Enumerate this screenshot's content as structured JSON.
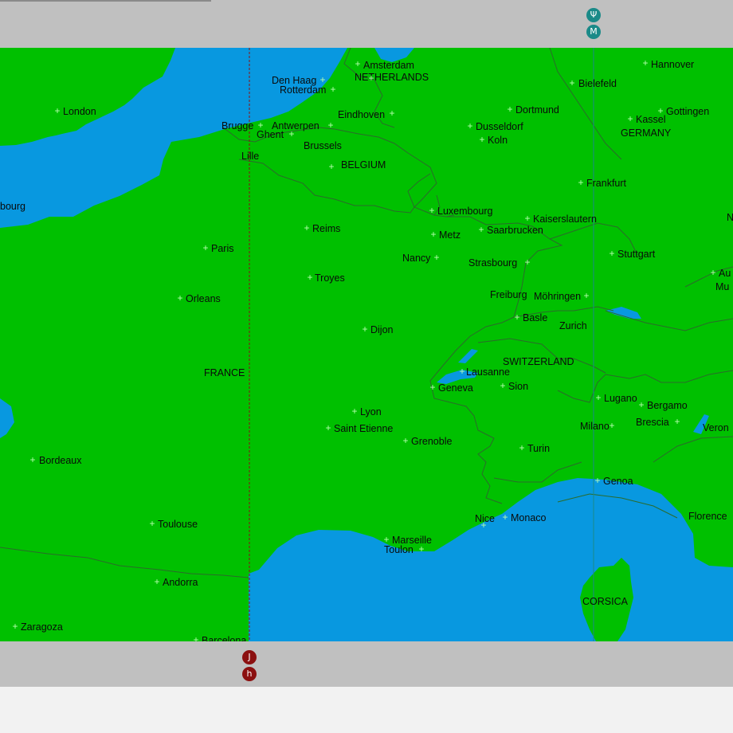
{
  "colors": {
    "land": "#00c000",
    "water": "#0898e0",
    "toolbar": "#c0c0c0",
    "cursor_a": "#1a8a88",
    "cursor_b": "#8b1010"
  },
  "countries": {
    "netherlands": "NETHERLANDS",
    "belgium": "BELGIUM",
    "germany": "GERMANY",
    "france": "FRANCE",
    "switzerland": "SWITZERLAND",
    "corsica": "CORSICA"
  },
  "cities": [
    {
      "id": "amsterdam",
      "name": "Amsterdam"
    },
    {
      "id": "den-haag",
      "name": "Den Haag"
    },
    {
      "id": "rotterdam",
      "name": "Rotterdam"
    },
    {
      "id": "hannover",
      "name": "Hannover"
    },
    {
      "id": "bielefeld",
      "name": "Bielefeld"
    },
    {
      "id": "london",
      "name": "London"
    },
    {
      "id": "eindhoven",
      "name": "Eindhoven"
    },
    {
      "id": "dortmund",
      "name": "Dortmund"
    },
    {
      "id": "kassel",
      "name": "Kassel"
    },
    {
      "id": "gottingen",
      "name": "Gottingen"
    },
    {
      "id": "brugge",
      "name": "Brugge"
    },
    {
      "id": "antwerpen",
      "name": "Antwerpen"
    },
    {
      "id": "dusseldorf",
      "name": "Dusseldorf"
    },
    {
      "id": "ghent",
      "name": "Ghent"
    },
    {
      "id": "koln",
      "name": "Koln"
    },
    {
      "id": "brussels",
      "name": "Brussels"
    },
    {
      "id": "lille",
      "name": "Lille"
    },
    {
      "id": "cherbourg",
      "name": "bourg"
    },
    {
      "id": "frankfurt",
      "name": "Frankfurt"
    },
    {
      "id": "luxembourg",
      "name": "Luxembourg"
    },
    {
      "id": "kaiserslautern",
      "name": "Kaiserslautern"
    },
    {
      "id": "reims",
      "name": "Reims"
    },
    {
      "id": "metz",
      "name": "Metz"
    },
    {
      "id": "saarbrucken",
      "name": "Saarbrucken"
    },
    {
      "id": "paris",
      "name": "Paris"
    },
    {
      "id": "nancy",
      "name": "Nancy"
    },
    {
      "id": "strasbourg",
      "name": "Strasbourg"
    },
    {
      "id": "stuttgart",
      "name": "Stuttgart"
    },
    {
      "id": "troyes",
      "name": "Troyes"
    },
    {
      "id": "orleans",
      "name": "Orleans"
    },
    {
      "id": "freiburg",
      "name": "Freiburg"
    },
    {
      "id": "mohringen",
      "name": "Möhringen"
    },
    {
      "id": "basle",
      "name": "Basle"
    },
    {
      "id": "zurich",
      "name": "Zurich"
    },
    {
      "id": "dijon",
      "name": "Dijon"
    },
    {
      "id": "lausanne",
      "name": "Lausanne"
    },
    {
      "id": "geneva",
      "name": "Geneva"
    },
    {
      "id": "sion",
      "name": "Sion"
    },
    {
      "id": "lugano",
      "name": "Lugano"
    },
    {
      "id": "bergamo",
      "name": "Bergamo"
    },
    {
      "id": "lyon",
      "name": "Lyon"
    },
    {
      "id": "saint-etienne",
      "name": "Saint Etienne"
    },
    {
      "id": "milano",
      "name": "Milano"
    },
    {
      "id": "brescia",
      "name": "Brescia"
    },
    {
      "id": "verona",
      "name": "Veron"
    },
    {
      "id": "grenoble",
      "name": "Grenoble"
    },
    {
      "id": "turin",
      "name": "Turin"
    },
    {
      "id": "bordeaux",
      "name": "Bordeaux"
    },
    {
      "id": "genoa",
      "name": "Genoa"
    },
    {
      "id": "florence",
      "name": "Florence"
    },
    {
      "id": "toulouse",
      "name": "Toulouse"
    },
    {
      "id": "nice",
      "name": "Nice"
    },
    {
      "id": "monaco",
      "name": "Monaco"
    },
    {
      "id": "marseille",
      "name": "Marseille"
    },
    {
      "id": "toulon",
      "name": "Toulon"
    },
    {
      "id": "andorra",
      "name": "Andorra"
    },
    {
      "id": "zaragoza",
      "name": "Zaragoza"
    },
    {
      "id": "barcelona",
      "name": "Barcelona"
    },
    {
      "id": "augsburg",
      "name": "Au"
    },
    {
      "id": "munich",
      "name": "Mu"
    },
    {
      "id": "nurnberg",
      "name": "N"
    }
  ],
  "markers": {
    "cursor_a_top": "Ψ",
    "cursor_a_bottom": "M",
    "cursor_b_top": "J",
    "cursor_b_bottom": "h"
  }
}
